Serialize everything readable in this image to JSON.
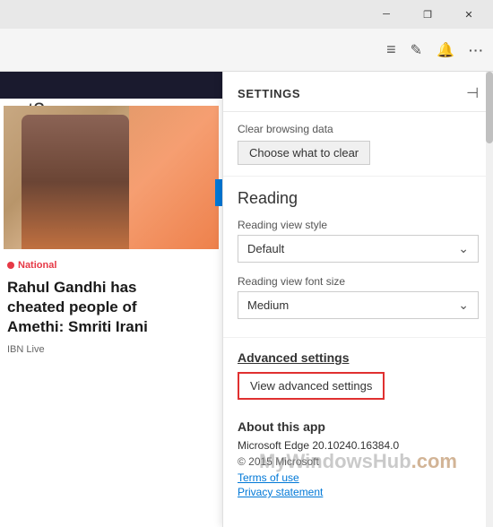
{
  "titleBar": {
    "minimizeLabel": "─",
    "maximizeLabel": "❐",
    "closeLabel": "✕"
  },
  "toolbar": {
    "hamburgerIcon": "≡",
    "editIcon": "✎",
    "notificationIcon": "🔔",
    "moreIcon": "···"
  },
  "news": {
    "pageTitle": "ext?",
    "tag": "National",
    "headline": "Rahul Gandhi has\ncheated people of\nAmethi: Smriti Irani",
    "source": "IBN Live"
  },
  "settings": {
    "title": "SETTINGS",
    "pinIcon": "⊕",
    "clearBrowsing": {
      "label": "Clear browsing data",
      "buttonLabel": "Choose what to clear"
    },
    "reading": {
      "sectionTitle": "Reading",
      "viewStyleLabel": "Reading view style",
      "viewStyleValue": "Default",
      "fontSizeLabel": "Reading view font size",
      "fontSizeValue": "Medium"
    },
    "advanced": {
      "sectionTitle": "Advanced settings",
      "buttonLabel": "View advanced settings"
    },
    "about": {
      "sectionTitle": "About this app",
      "version": "Microsoft Edge 20.10240.16384.0",
      "copyright": "© 2015 Microsoft",
      "termsLink": "Terms of use",
      "privacyLink": "Privacy statement"
    }
  },
  "watermark": "MyWindowsHub",
  "watermark2": ".com"
}
